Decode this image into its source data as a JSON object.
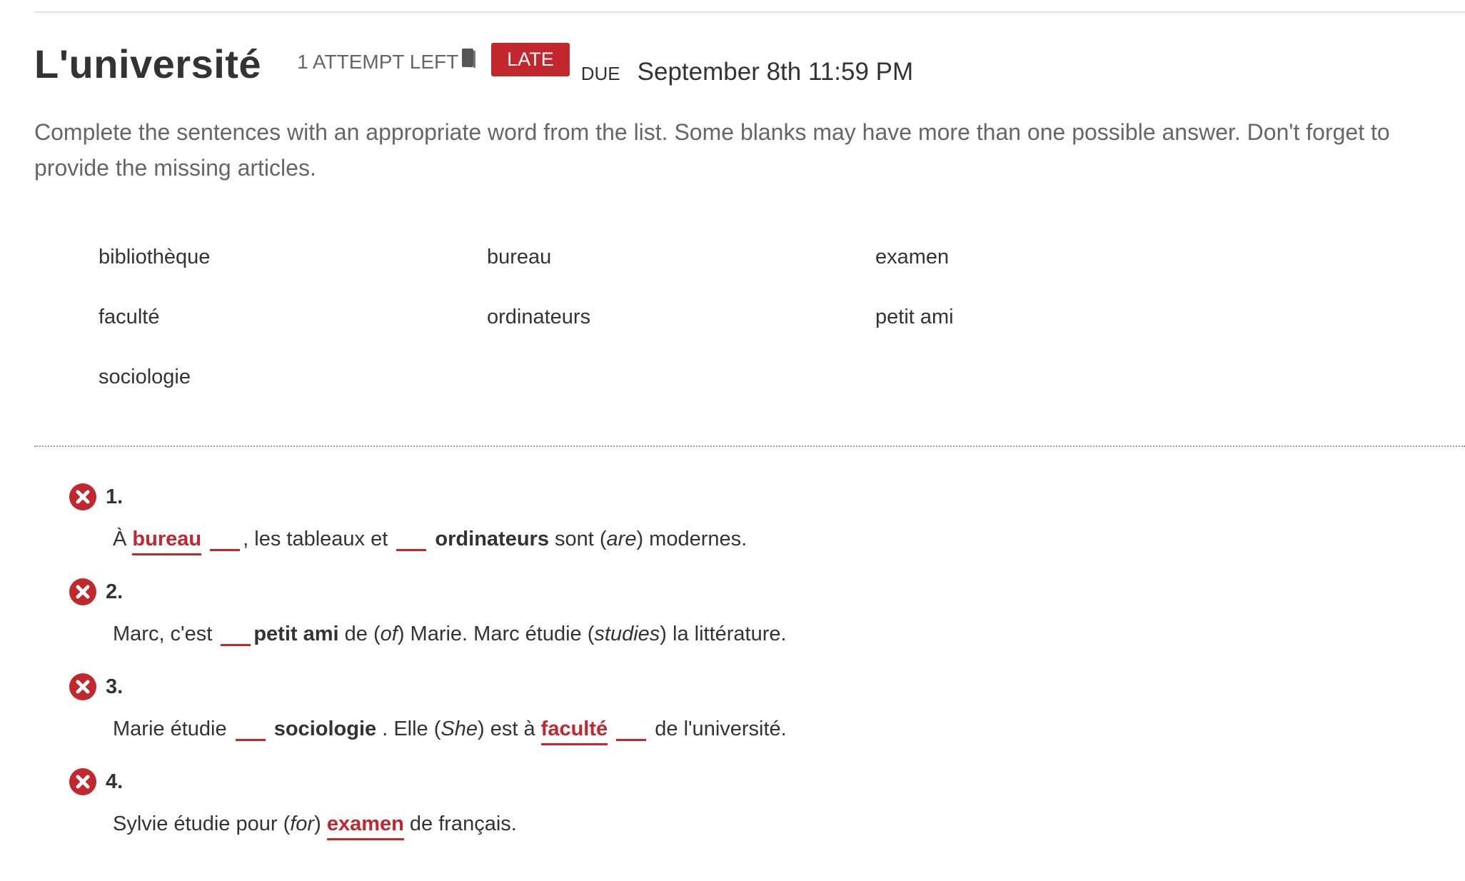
{
  "header": {
    "title": "L'université",
    "attempts": "1 ATTEMPT LEFT",
    "status_badge": "LATE",
    "due_label": "DUE",
    "due_date": "September 8th 11:59 PM"
  },
  "instructions": "Complete the sentences with an appropriate word from the list. Some blanks may have more than one possible answer. Don't forget to provide the missing articles.",
  "word_bank": [
    [
      "bibliothèque",
      "bureau",
      "examen"
    ],
    [
      "faculté",
      "ordinateurs",
      "petit ami"
    ],
    [
      "sociologie"
    ]
  ],
  "questions": [
    {
      "number": "1.",
      "status": "incorrect",
      "segments": {
        "t1": "À",
        "a1": "bureau",
        "t2": ", les tableaux et",
        "w1": "ordinateurs",
        "t3": "sont (",
        "i1": "are",
        "t4": ") modernes."
      }
    },
    {
      "number": "2.",
      "status": "incorrect",
      "segments": {
        "t1": "Marc, c'est",
        "w1": "petit ami",
        "t2": "de (",
        "i1": "of",
        "t3": ") Marie. Marc étudie (",
        "i2": "studies",
        "t4": ") la littérature."
      }
    },
    {
      "number": "3.",
      "status": "incorrect",
      "segments": {
        "t1": "Marie étudie",
        "w1": "sociologie",
        "t2": ". Elle (",
        "i1": "She",
        "t3": ") est à",
        "a1": "faculté",
        "t4": "de l'université."
      }
    },
    {
      "number": "4.",
      "status": "incorrect",
      "segments": {
        "t1": "Sylvie étudie pour (",
        "i1": "for",
        "t2": ")",
        "a1": "examen",
        "t3": "de français."
      }
    }
  ],
  "colors": {
    "accent_red": "#c1272d",
    "text": "#333333",
    "muted": "#666666"
  }
}
